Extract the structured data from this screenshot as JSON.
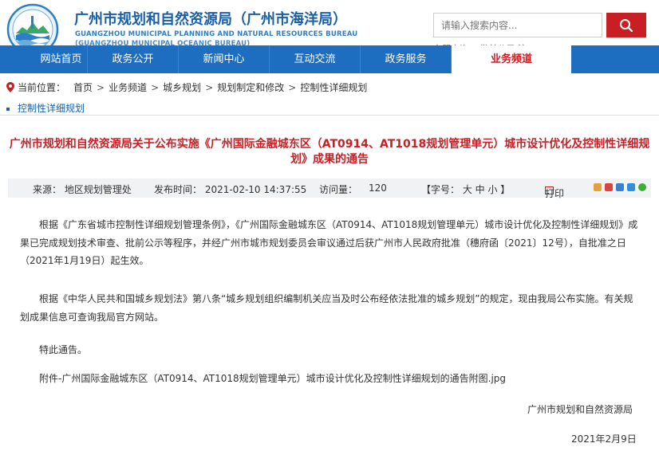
{
  "header": {
    "title_cn": "广州市规划和自然资源局（广州市海洋局）",
    "title_en_1": "GUANGZHOU MUNICIPAL PLANNING AND NATURAL RESOURCES BUREAU",
    "title_en_2": "(GUANGZHOU MUNICIPAL OCEANIC BUREAU)",
    "search_placeholder": "请输入搜索内容...",
    "quick_links": "专题查询：  批前公示  注"
  },
  "nav": {
    "items": [
      "网站首页",
      "政务公开",
      "新闻中心",
      "互动交流",
      "政务服务",
      "业务频道"
    ],
    "active": "业务频道"
  },
  "breadcrumb": {
    "label": "当前位置：",
    "items": [
      "首页",
      "业务频道",
      "城乡规划",
      "规划制定和修改",
      "控制性详细规划"
    ],
    "separator": ">"
  },
  "section": {
    "title": "控制性详细规划"
  },
  "article": {
    "title": "广州市规划和自然资源局关于公布实施《广州国际金融城东区（AT0914、AT1018规划管理单元）城市设计优化及控制性详细规划》成果的通告",
    "meta": {
      "source": "来源：  地区规划管理处",
      "publish_time": "发布时间：  2021-02-10 14:37:55",
      "visits": "访问量：",
      "visits_count": "120",
      "font_size": "【字号：  大  中  小 】",
      "print": "打印"
    },
    "paragraph_1": "根据《广东省城市控制性详细规划管理条例》，《广州国际金融城东区（AT0914、AT1018规划管理单元）城市设计优化及控制性详细规划》成果已完成规划技术审查、批前公示等程序，并经广州市城市规划委员会审议通过后获广州市人民政府批准（穗府函〔2021〕12号），自批准之日（2021年1月19日）起生效。",
    "paragraph_2": "根据《中华人民共和国城乡规划法》第八条“城乡规划组织编制机关应当及时公布经依法批准的城乡规划”的规定，现由我局公布实施。有关规划成果信息可查询我局官方网站。",
    "notice": "特此通告。",
    "attachment": "附件-广州国际金融城东区（AT0914、AT1018规划管理单元）城市设计优化及控制性详细规划的通告附图.jpg",
    "signature": "广州市规划和自然资源局",
    "date": "2021年2月9日"
  },
  "colors": {
    "brand_blue": "#1d6dc1",
    "accent_red": "#c81f25"
  }
}
